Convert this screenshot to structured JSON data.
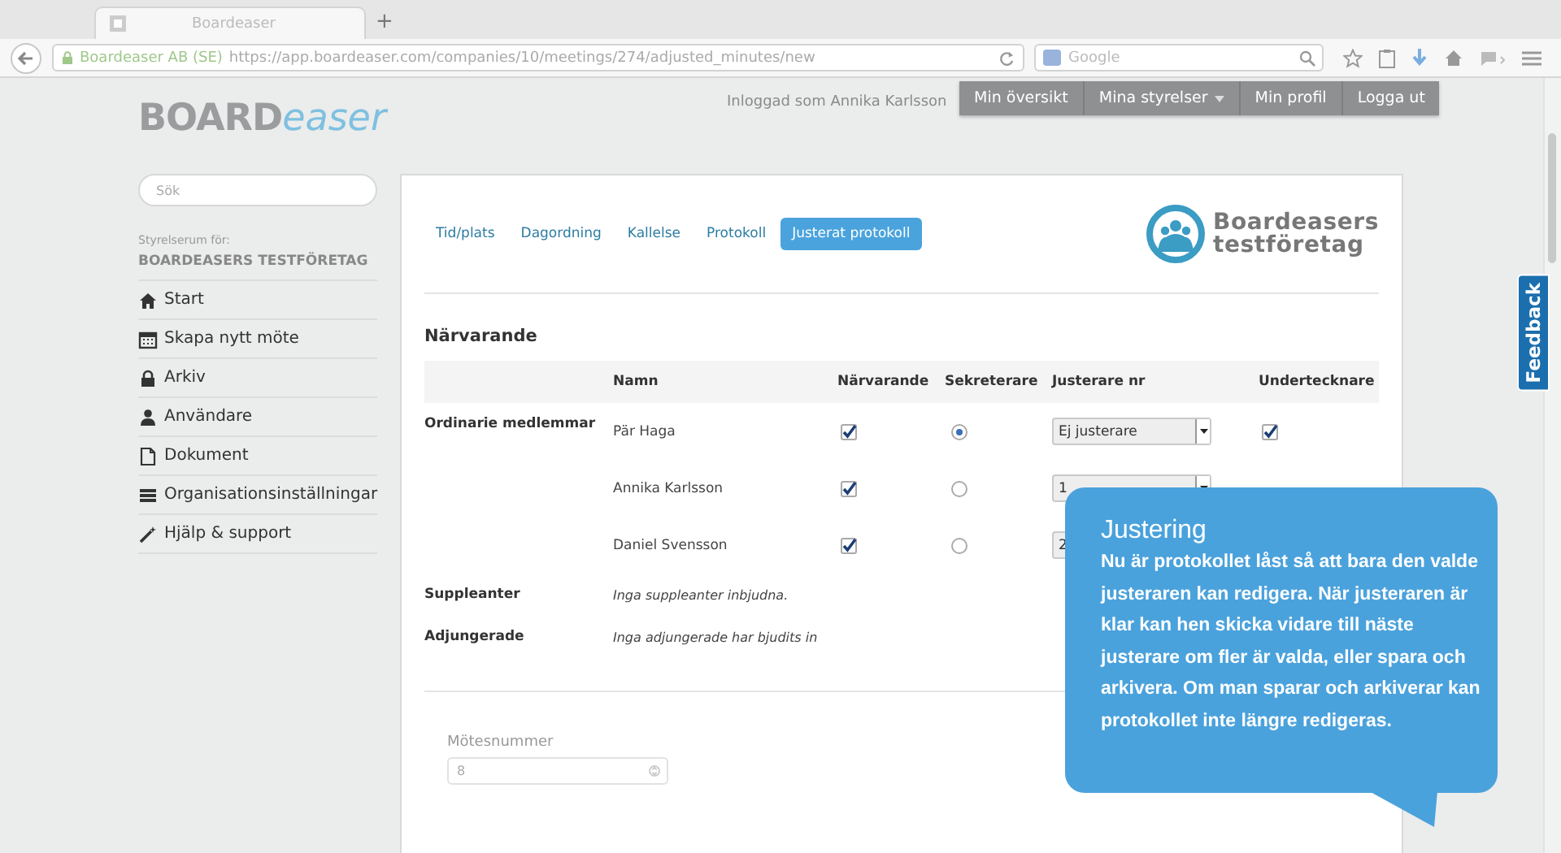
{
  "browser": {
    "tab_title": "Boardeaser",
    "new_tab": "+",
    "site_identity": "Boardeaser AB (SE)",
    "url": "https://app.boardeaser.com/companies/10/meetings/274/adjusted_minutes/new",
    "search_placeholder": "Google"
  },
  "header": {
    "logo": {
      "part_1": "BOARD",
      "part_2": "easer"
    },
    "logged_in": "Inloggad som Annika Karlsson",
    "nav": [
      {
        "label": "Min översikt",
        "dropdown": false
      },
      {
        "label": "Mina styrelser",
        "dropdown": true
      },
      {
        "label": "Min profil",
        "dropdown": false
      },
      {
        "label": "Logga ut",
        "dropdown": false
      }
    ]
  },
  "sidebar": {
    "search_placeholder": "Sök",
    "room_label": "Styrelserum för:",
    "company": "BOARDEASERS TESTFÖRETAG",
    "items": [
      {
        "label": "Start",
        "kind": "home"
      },
      {
        "label": "Skapa nytt möte",
        "kind": "calendar"
      },
      {
        "label": "Arkiv",
        "kind": "lock"
      },
      {
        "label": "Användare",
        "kind": "user"
      },
      {
        "label": "Dokument",
        "kind": "document"
      },
      {
        "label": "Organisationsinställningar",
        "kind": "list"
      },
      {
        "label": "Hjälp & support",
        "kind": "wand"
      }
    ]
  },
  "tabs": [
    {
      "label": "Tid/plats",
      "selected": false
    },
    {
      "label": "Dagordning",
      "selected": false
    },
    {
      "label": "Kallelse",
      "selected": false
    },
    {
      "label": "Protokoll",
      "selected": false
    },
    {
      "label": "Justerat protokoll",
      "selected": true
    }
  ],
  "company_logo": {
    "line_1": "Boardeasers",
    "line_2": "testföretag"
  },
  "section_title": "Närvarande",
  "table": {
    "columns": [
      "Namn",
      "Närvarande",
      "Sekreterare",
      "Justerare nr",
      "Undertecknare"
    ],
    "groups": [
      {
        "label": "Ordinarie medlemmar",
        "members": [
          {
            "name": "Pär Haga",
            "present": true,
            "secretary": true,
            "adjuster": "Ej justerare",
            "signer": true
          },
          {
            "name": "Annika Karlsson",
            "present": true,
            "secretary": false,
            "adjuster": "1"
          },
          {
            "name": "Daniel Svensson",
            "present": true,
            "secretary": false,
            "adjuster": "2"
          }
        ]
      },
      {
        "label": "Suppleanter",
        "note": "Inga suppleanter inbjudna."
      },
      {
        "label": "Adjungerade",
        "note": "Inga adjungerade har bjudits in"
      }
    ]
  },
  "meeting_number": {
    "label": "Mötesnummer",
    "value": "8"
  },
  "feedback": "Feedback",
  "tooltip": {
    "title": "Justering",
    "body": "Nu är protokollet låst så att bara den valde justeraren kan redigera. När justeraren är klar kan hen skicka vidare till näste justerare om fler är valda, eller spara och arkivera. Om man sparar och arkiverar kan protokollet inte längre redigeras."
  }
}
